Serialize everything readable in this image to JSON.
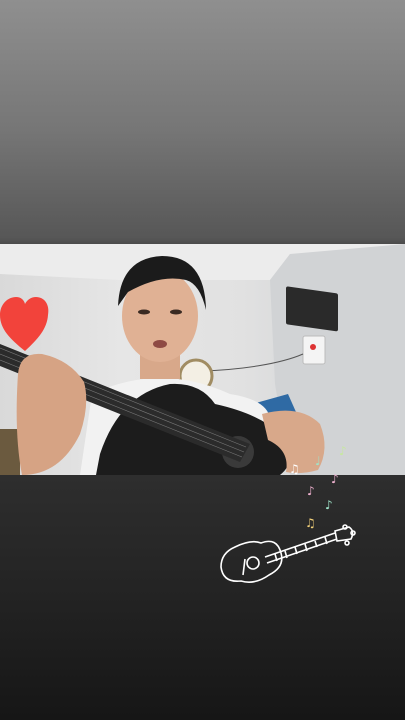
{
  "screen": {
    "top_color": "#8f8f8f",
    "bottom_color": "#141414"
  },
  "video": {
    "description_icon": "person-playing-guitar-video",
    "wall_color": "#e3e3e3",
    "guitar_color": "#1c1c1c"
  },
  "stickers": {
    "heart_icon": "heart-icon",
    "heart_color": "#f2433b",
    "ukulele_icon": "ukulele-sticker-icon",
    "music_notes_icon": "music-notes-icon",
    "note_colors": [
      "#f5d37a",
      "#9fe3c9",
      "#f0b2d0",
      "#ffffff",
      "#c7e8a0"
    ]
  }
}
